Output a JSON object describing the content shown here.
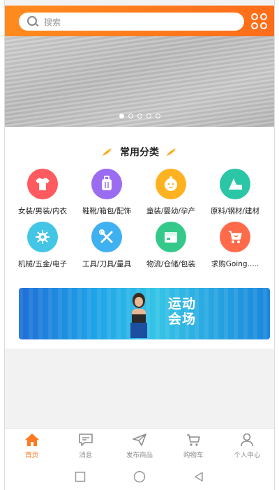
{
  "search": {
    "placeholder": "搜索"
  },
  "header": {
    "menu_icon": "grid-icon",
    "accent": "#ff7a1e"
  },
  "banner": {
    "slide_count": 5,
    "active_slide": 1
  },
  "categories": {
    "title": "常用分类",
    "items": [
      {
        "label": "女装/男装/内衣",
        "icon": "tshirt-icon",
        "color": "#ff5a5f"
      },
      {
        "label": "鞋靴/箱包/配饰",
        "icon": "luggage-icon",
        "color": "#9b6cf2"
      },
      {
        "label": "童装/婴幼/孕产",
        "icon": "baby-face-icon",
        "color": "#ffb21f"
      },
      {
        "label": "原料/钢材/建材",
        "icon": "material-icon",
        "color": "#2bc6a6"
      },
      {
        "label": "机械/五金/电子",
        "icon": "gear-icon",
        "color": "#43c6e6"
      },
      {
        "label": "工具/刀具/量具",
        "icon": "tools-icon",
        "color": "#3fb0f0"
      },
      {
        "label": "物流/仓储/包装",
        "icon": "box-icon",
        "color": "#34c98a"
      },
      {
        "label": "求购Going.....",
        "icon": "cart-icon",
        "color": "#ff6b4a"
      }
    ]
  },
  "promo": {
    "title_line1": "运动",
    "title_line2": "会场"
  },
  "bottom_nav": [
    {
      "label": "首页",
      "icon": "home-icon",
      "active": true
    },
    {
      "label": "消息",
      "icon": "message-icon",
      "active": false
    },
    {
      "label": "发布商品",
      "icon": "send-icon",
      "active": false
    },
    {
      "label": "购物车",
      "icon": "cart-icon",
      "active": false
    },
    {
      "label": "个人中心",
      "icon": "user-icon",
      "active": false
    }
  ],
  "system_nav": [
    "recents-icon",
    "home-circle-icon",
    "back-icon"
  ]
}
